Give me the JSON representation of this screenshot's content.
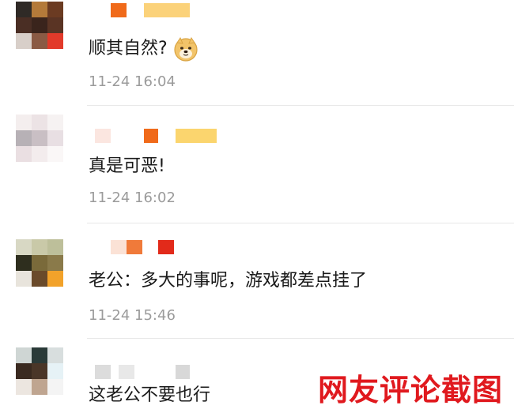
{
  "comments": [
    {
      "text": "顺其自然?",
      "emoji": "doge-emoji",
      "time": "11-24 16:04"
    },
    {
      "text": "真是可恶!",
      "time": "11-24 16:02"
    },
    {
      "text": "老公：多大的事呢，游戏都差点挂了",
      "time": "11-24 15:46"
    },
    {
      "text": "这老公不要也行"
    }
  ],
  "watermark": "网友评论截图",
  "colors": {
    "time": "#9b9b9b",
    "watermark": "#e0191e",
    "divider": "#e8e8e8"
  }
}
